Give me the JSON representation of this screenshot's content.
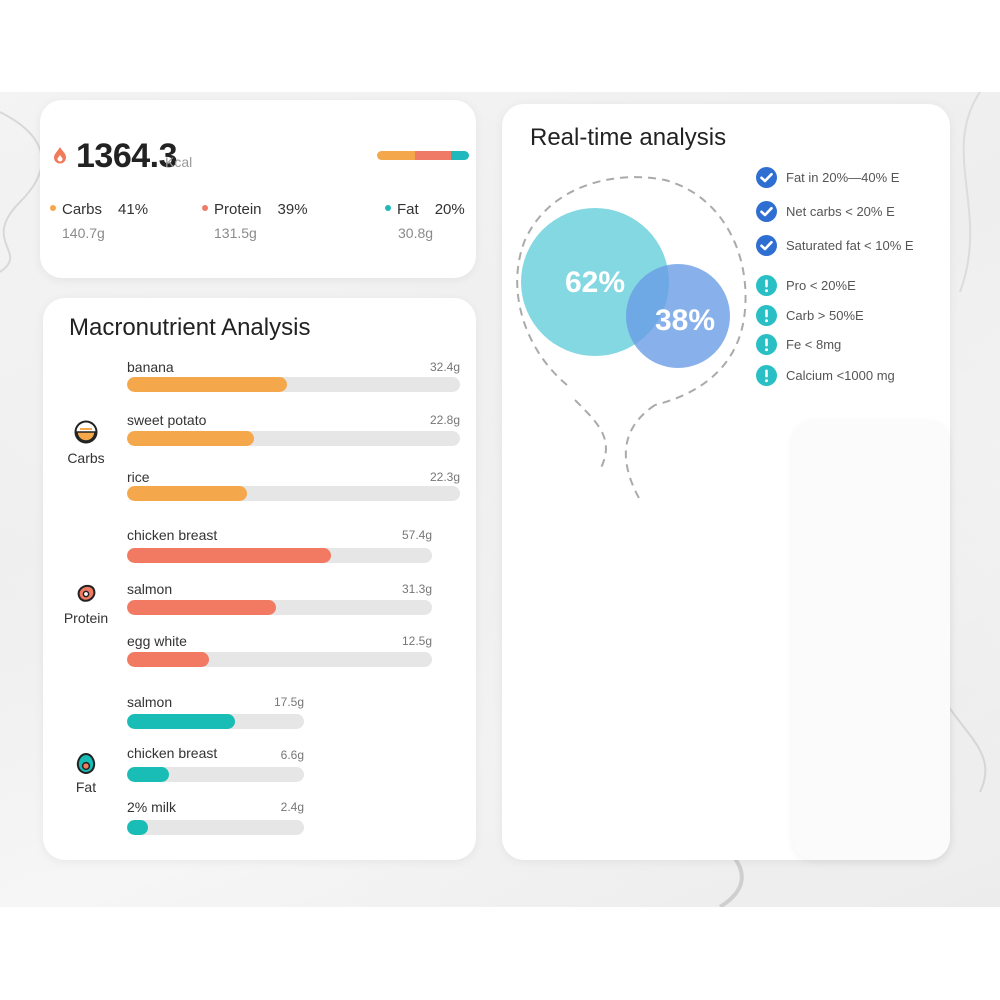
{
  "summary": {
    "calories": "1364.3",
    "unit": "Kcal",
    "macros": [
      {
        "name": "Carbs",
        "pct": "41%",
        "grams": "140.7g",
        "color": "#f5a84b"
      },
      {
        "name": "Protein",
        "pct": "39%",
        "grams": "131.5g",
        "color": "#ef7a65"
      },
      {
        "name": "Fat",
        "pct": "20%",
        "grams": "30.8g",
        "color": "#1fb8bd"
      }
    ]
  },
  "macro_analysis": {
    "title": "Macronutrient Analysis",
    "categories": [
      {
        "label": "Carbs",
        "icon": "rice-bowl-icon",
        "color": "#f5a84b",
        "items": [
          {
            "name": "banana",
            "value": "32.4g",
            "fraction": 0.48
          },
          {
            "name": "sweet potato",
            "value": "22.8g",
            "fraction": 0.38
          },
          {
            "name": "rice",
            "value": "22.3g",
            "fraction": 0.36
          }
        ]
      },
      {
        "label": "Protein",
        "icon": "meat-icon",
        "color": "#f27a63",
        "items": [
          {
            "name": "chicken breast",
            "value": "57.4g",
            "fraction": 0.67
          },
          {
            "name": "salmon",
            "value": "31.3g",
            "fraction": 0.49
          },
          {
            "name": "egg white",
            "value": "12.5g",
            "fraction": 0.27
          }
        ]
      },
      {
        "label": "Fat",
        "icon": "avocado-icon",
        "color": "#19bdb5",
        "items": [
          {
            "name": "salmon",
            "value": "17.5g",
            "fraction": 0.61
          },
          {
            "name": "chicken breast",
            "value": "6.6g",
            "fraction": 0.24
          },
          {
            "name": "2% milk",
            "value": "2.4g",
            "fraction": 0.12
          }
        ]
      }
    ]
  },
  "realtime": {
    "title": "Real-time analysis",
    "venn": {
      "left": "62%",
      "right": "38%",
      "left_color": "#6fd1dd",
      "right_color": "#6a9ee6"
    },
    "checks": [
      {
        "text": "Fat in 20%—40% E",
        "status": "ok"
      },
      {
        "text": "Net carbs < 20% E",
        "status": "ok"
      },
      {
        "text": "Saturated fat < 10% E",
        "status": "ok"
      },
      {
        "text": "Pro < 20%E",
        "status": "warn"
      },
      {
        "text": "Carb > 50%E",
        "status": "warn"
      },
      {
        "text": "Fe < 8mg",
        "status": "warn"
      },
      {
        "text": "Calcium <1000 mg",
        "status": "warn"
      }
    ]
  }
}
